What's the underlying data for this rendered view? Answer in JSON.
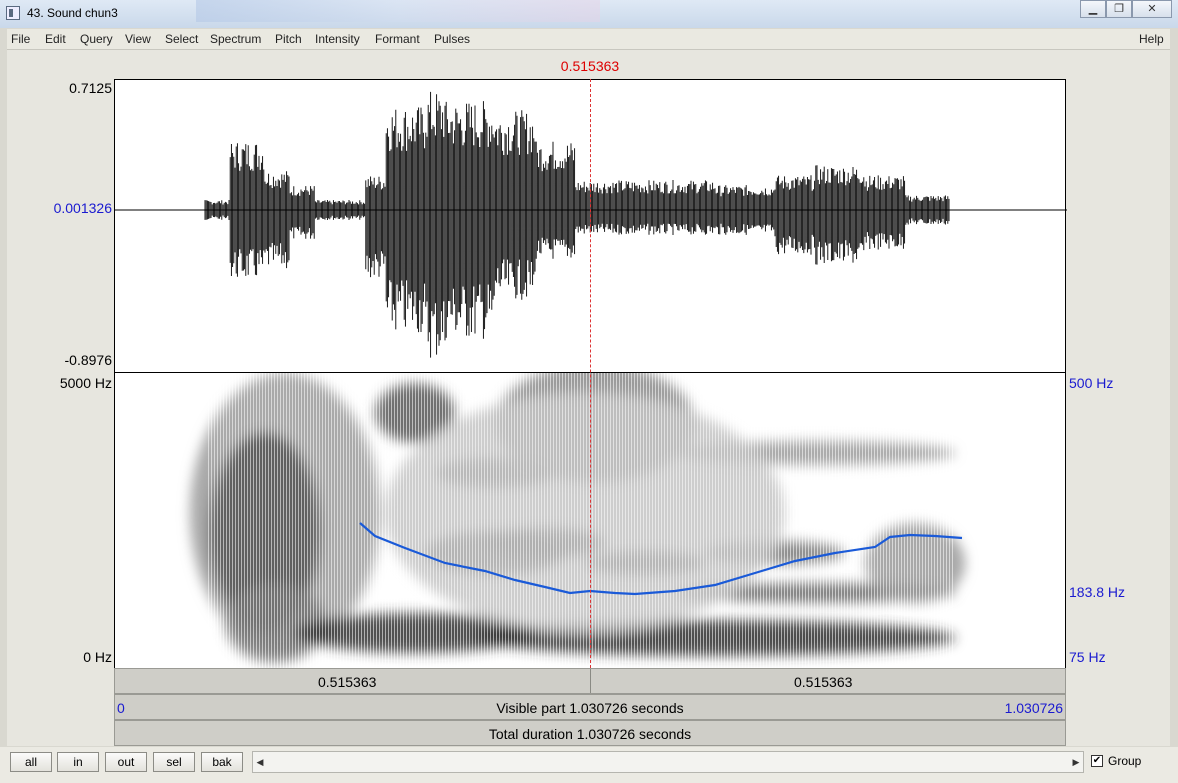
{
  "window": {
    "title": "43. Sound chun3"
  },
  "menubar": {
    "items": [
      "File",
      "Edit",
      "Query",
      "View",
      "Select",
      "Spectrum",
      "Pitch",
      "Intensity",
      "Formant",
      "Pulses"
    ],
    "help": "Help"
  },
  "cursor": {
    "time": "0.515363"
  },
  "waveform": {
    "y_max": "0.7125",
    "y_mid": "0.001326",
    "y_min": "-0.8976"
  },
  "spectrogram": {
    "freq_max": "5000 Hz",
    "freq_min": "0 Hz",
    "pitch_max": "500 Hz",
    "pitch_current": "183.8 Hz",
    "pitch_min": "75 Hz",
    "pitch_color": "#1a5ad8"
  },
  "time_bar": {
    "left": "0.515363",
    "right": "0.515363"
  },
  "visible_bar": {
    "start": "0",
    "text": "Visible part 1.030726 seconds",
    "end": "1.030726"
  },
  "total_bar": {
    "text": "Total duration 1.030726 seconds"
  },
  "bottom": {
    "buttons": [
      "all",
      "in",
      "out",
      "sel",
      "bak"
    ],
    "group_label": "Group",
    "group_checked": true
  }
}
